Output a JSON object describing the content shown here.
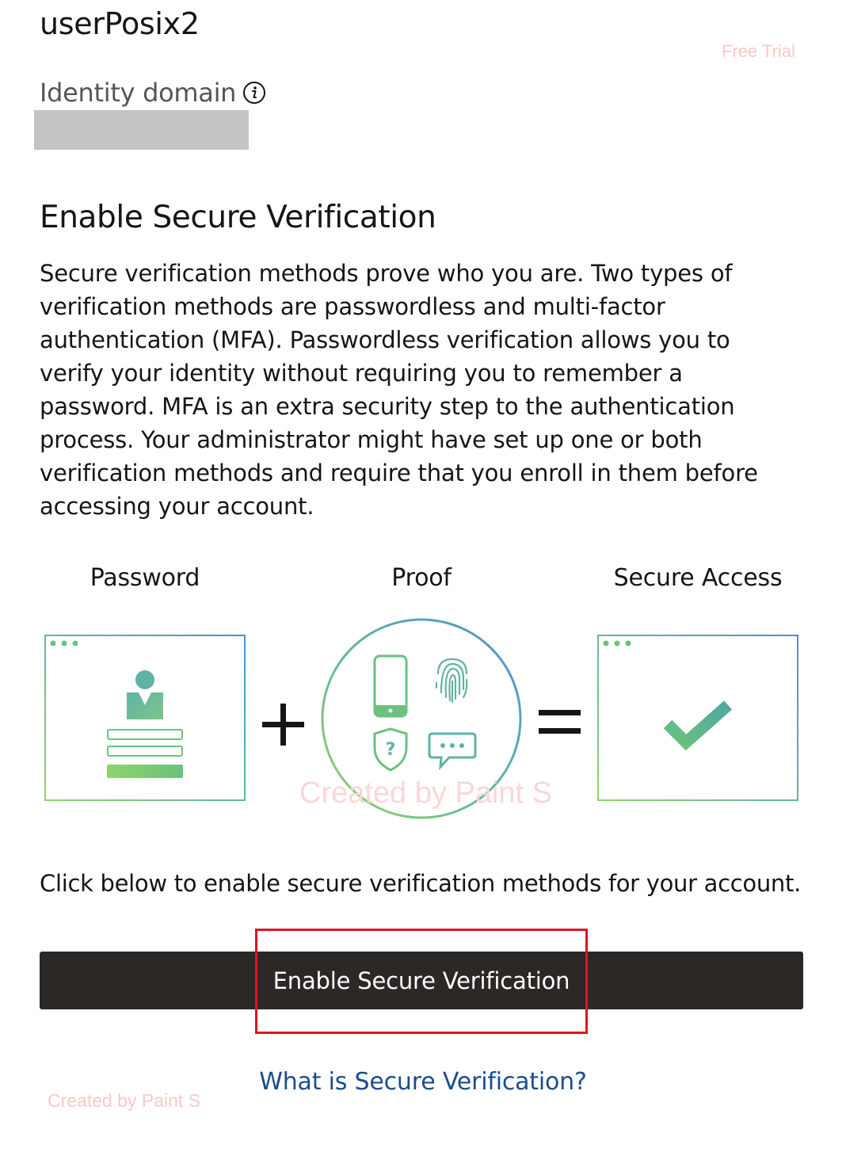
{
  "header": {
    "username": "userPosix2",
    "free_trial": "Free Trial",
    "domain_label": "Identity domain"
  },
  "main": {
    "heading": "Enable Secure Verification",
    "description": "Secure verification methods prove who you are. Two types of verification methods are passwordless and multi-factor authentication (MFA). Passwordless verification allows you to verify your identity without requiring you to remember a password. MFA is an extra security step to the authentication process. Your administrator might have set up one or both verification methods and require that you enroll in them before accessing your account.",
    "diagram": {
      "password_label": "Password",
      "proof_label": "Proof",
      "access_label": "Secure Access",
      "proof_icons": [
        "phone-icon",
        "fingerprint-icon",
        "shield-question-icon",
        "chat-icon"
      ]
    },
    "instruction": "Click below to enable secure verification methods for your account.",
    "enable_button": "Enable Secure Verification",
    "help_link": "What is Secure Verification?"
  },
  "watermarks": {
    "center": "Created by Paint S",
    "bottom": "Created by Paint S"
  },
  "colors": {
    "button_bg": "#2b2826",
    "link": "#1a4d8c",
    "highlight": "#e3131f",
    "gradient_teal": "#5fb3a6",
    "gradient_green": "#8fd46a",
    "gradient_blue": "#4a8fd6"
  }
}
